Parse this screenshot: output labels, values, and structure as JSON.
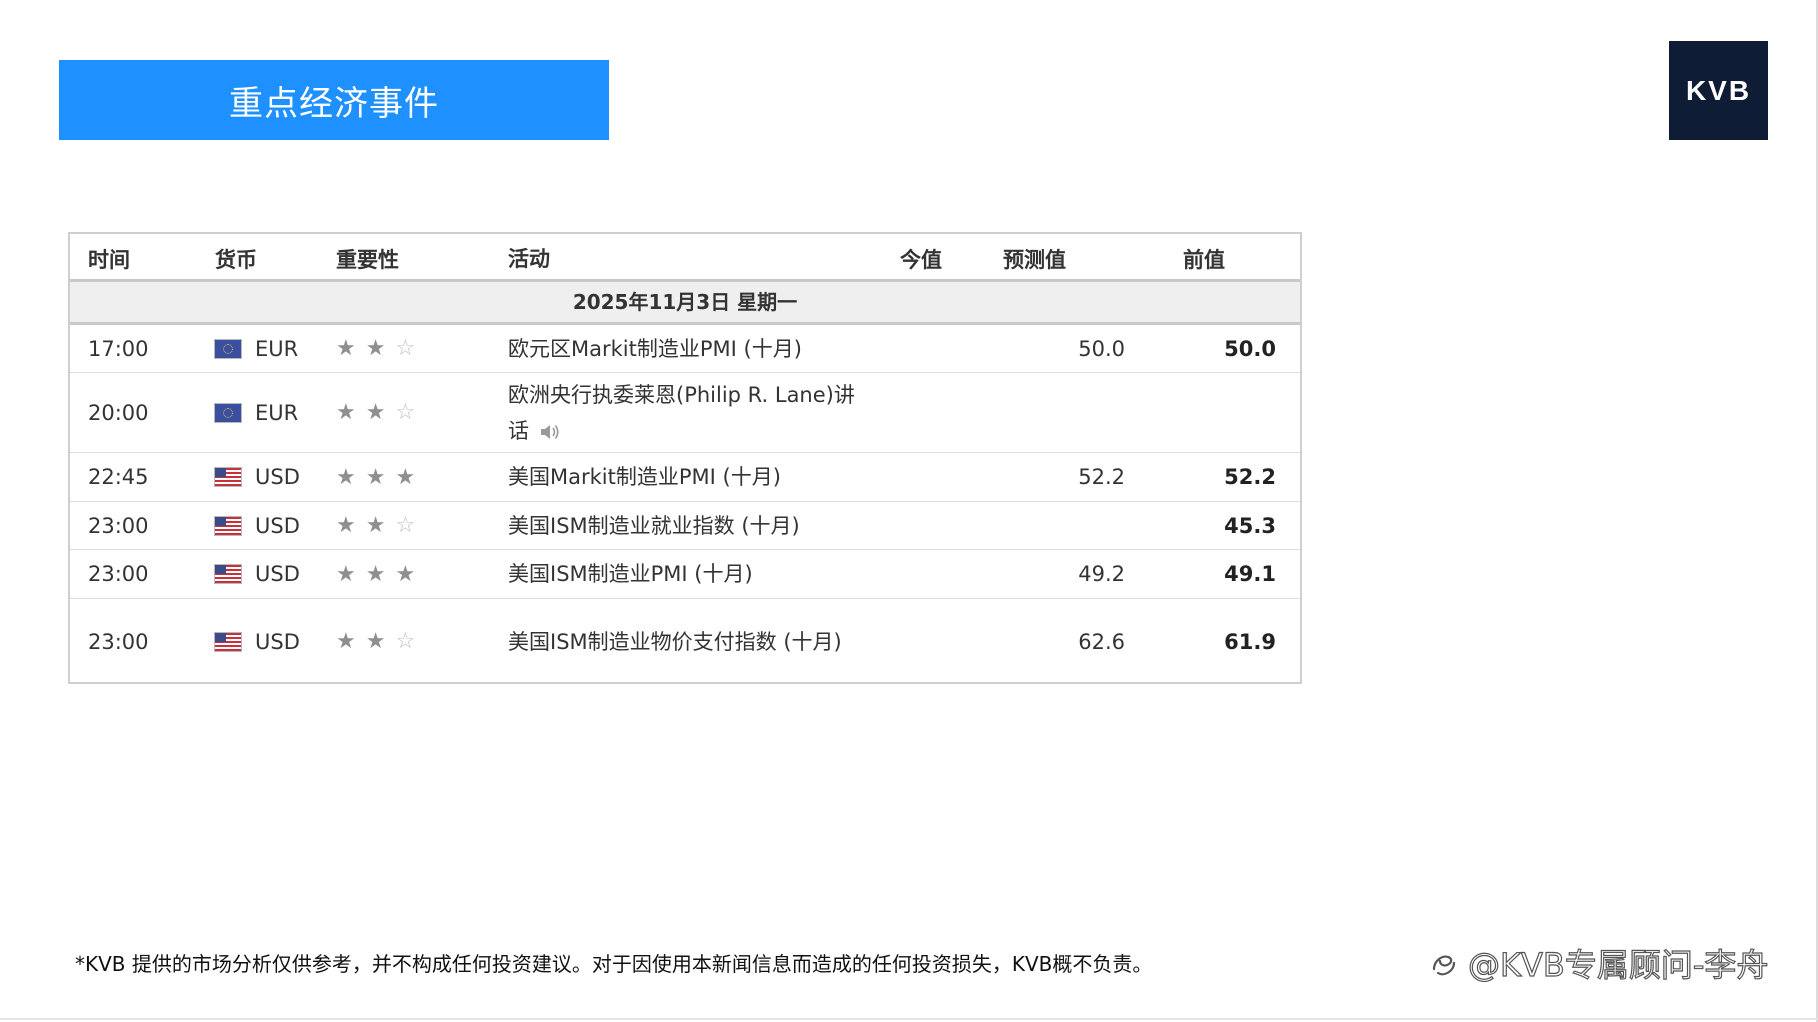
{
  "banner": {
    "title": "重点经济事件"
  },
  "logo": {
    "text": "KVB"
  },
  "table": {
    "headers": {
      "time": "时间",
      "currency": "货币",
      "importance": "重要性",
      "event": "活动",
      "actual": "今值",
      "forecast": "预测值",
      "previous": "前值"
    },
    "date": "2025年11月3日  星期一",
    "rows": [
      {
        "time": "17:00",
        "currency": "EUR",
        "flag": "eu-flag-icon",
        "stars": 2,
        "event": "欧元区Markit制造业PMI (十月)",
        "has_audio": false,
        "actual": "",
        "forecast": "50.0",
        "previous": "50.0"
      },
      {
        "time": "20:00",
        "currency": "EUR",
        "flag": "eu-flag-icon",
        "stars": 2,
        "event": "欧洲央行执委莱恩(Philip R. Lane)讲话",
        "has_audio": true,
        "actual": "",
        "forecast": "",
        "previous": ""
      },
      {
        "time": "22:45",
        "currency": "USD",
        "flag": "us-flag-icon",
        "stars": 3,
        "event": "美国Markit制造业PMI (十月)",
        "has_audio": false,
        "actual": "",
        "forecast": "52.2",
        "previous": "52.2"
      },
      {
        "time": "23:00",
        "currency": "USD",
        "flag": "us-flag-icon",
        "stars": 2,
        "event": "美国ISM制造业就业指数 (十月)",
        "has_audio": false,
        "actual": "",
        "forecast": "",
        "previous": "45.3"
      },
      {
        "time": "23:00",
        "currency": "USD",
        "flag": "us-flag-icon",
        "stars": 3,
        "event": "美国ISM制造业PMI (十月)",
        "has_audio": false,
        "actual": "",
        "forecast": "49.2",
        "previous": "49.1"
      },
      {
        "time": "23:00",
        "currency": "USD",
        "flag": "us-flag-icon",
        "stars": 2,
        "event": "美国ISM制造业物价支付指数 (十月)",
        "has_audio": false,
        "actual": "",
        "forecast": "62.6",
        "previous": "61.9"
      }
    ]
  },
  "disclaimer": "*KVB 提供的市场分析仅供参考，并不构成任何投资建议。对于因使用本新闻信息而造成的任何投资损失，KVB概不负责。",
  "watermark": "@KVB专属顾问-李舟",
  "colors": {
    "banner": "#1e90ff",
    "logo_bg": "#0f1c35",
    "date_row_bg": "#efefef",
    "star": "#8f8f8f"
  }
}
